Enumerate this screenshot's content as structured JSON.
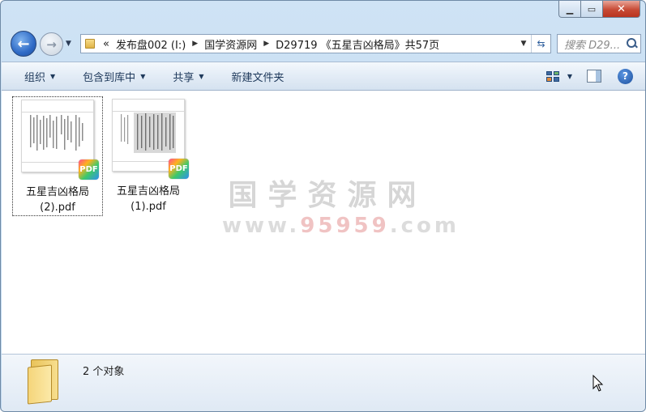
{
  "window": {
    "caption": {
      "minimize": "▁",
      "maximize": "▭",
      "close": "✕"
    }
  },
  "nav": {
    "back_glyph": "←",
    "forward_glyph": "→"
  },
  "address": {
    "overflow": "«",
    "parts": [
      "发布盘002 (I:)",
      "国学资源网",
      "D29719 《五星吉凶格局》共57页"
    ]
  },
  "search": {
    "placeholder": "搜索 D29..."
  },
  "toolbar": {
    "organize": "组织",
    "include_library": "包含到库中",
    "share": "共享",
    "new_folder": "新建文件夹"
  },
  "files": [
    {
      "name_line1": "五星吉凶格局",
      "name_line2": "(2).pdf",
      "badge": "PDF",
      "selected": true
    },
    {
      "name_line1": "五星吉凶格局",
      "name_line2": "(1).pdf",
      "badge": "PDF",
      "selected": false
    }
  ],
  "watermark": {
    "line1": "国学资源网",
    "line2_pre": "www.",
    "line2_hl": "95959",
    "line2_post": ".com"
  },
  "details": {
    "status": "2 个对象"
  },
  "help_label": "?"
}
